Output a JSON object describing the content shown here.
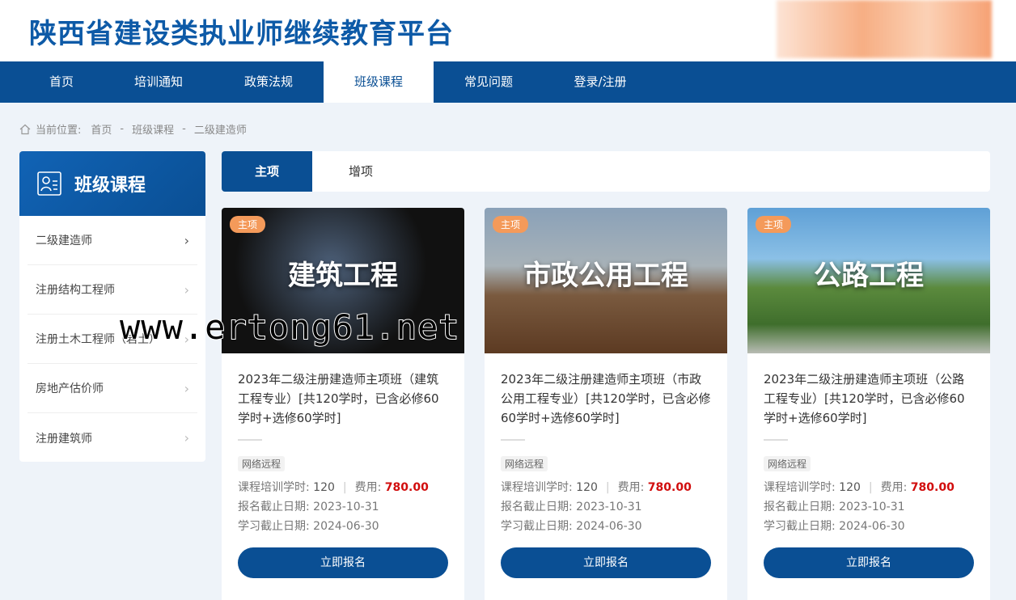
{
  "site": {
    "title": "陕西省建设类执业师继续教育平台"
  },
  "nav": [
    {
      "label": "首页",
      "active": false
    },
    {
      "label": "培训通知",
      "active": false
    },
    {
      "label": "政策法规",
      "active": false
    },
    {
      "label": "班级课程",
      "active": true
    },
    {
      "label": "常见问题",
      "active": false
    },
    {
      "label": "登录/注册",
      "active": false
    }
  ],
  "breadcrumb": {
    "prefix": "当前位置:",
    "items": [
      "首页",
      "班级课程",
      "二级建造师"
    ],
    "separator": "-"
  },
  "sidebar": {
    "title": "班级课程",
    "items": [
      {
        "label": "二级建造师",
        "active": true
      },
      {
        "label": "注册结构工程师",
        "active": false
      },
      {
        "label": "注册土木工程师（岩土）",
        "active": false
      },
      {
        "label": "房地产估价师",
        "active": false
      },
      {
        "label": "注册建筑师",
        "active": false
      }
    ]
  },
  "tabs": [
    {
      "label": "主项",
      "active": true
    },
    {
      "label": "增项",
      "active": false
    }
  ],
  "labels": {
    "hours": "课程培训学时:",
    "fee": "费用:",
    "reg_deadline": "报名截止日期:",
    "study_deadline": "学习截止日期:",
    "enroll_button": "立即报名"
  },
  "courses": [
    {
      "tag": "主项",
      "image_title": "建筑工程",
      "name": "2023年二级注册建造师主项班（建筑工程专业）[共120学时，已含必修60学时+选修60学时]",
      "mode": "网络远程",
      "hours": "120",
      "fee": "780.00",
      "reg_deadline": "2023-10-31",
      "study_deadline": "2024-06-30"
    },
    {
      "tag": "主项",
      "image_title": "市政公用工程",
      "name": "2023年二级注册建造师主项班（市政公用工程专业）[共120学时，已含必修60学时+选修60学时]",
      "mode": "网络远程",
      "hours": "120",
      "fee": "780.00",
      "reg_deadline": "2023-10-31",
      "study_deadline": "2024-06-30"
    },
    {
      "tag": "主项",
      "image_title": "公路工程",
      "name": "2023年二级注册建造师主项班（公路工程专业）[共120学时，已含必修60学时+选修60学时]",
      "mode": "网络远程",
      "hours": "120",
      "fee": "780.00",
      "reg_deadline": "2023-10-31",
      "study_deadline": "2024-06-30"
    }
  ],
  "watermark": "www.ertong61.net",
  "colors": {
    "primary": "#0a4f94",
    "price": "#d10d0d",
    "tag": "#f49a5a"
  }
}
